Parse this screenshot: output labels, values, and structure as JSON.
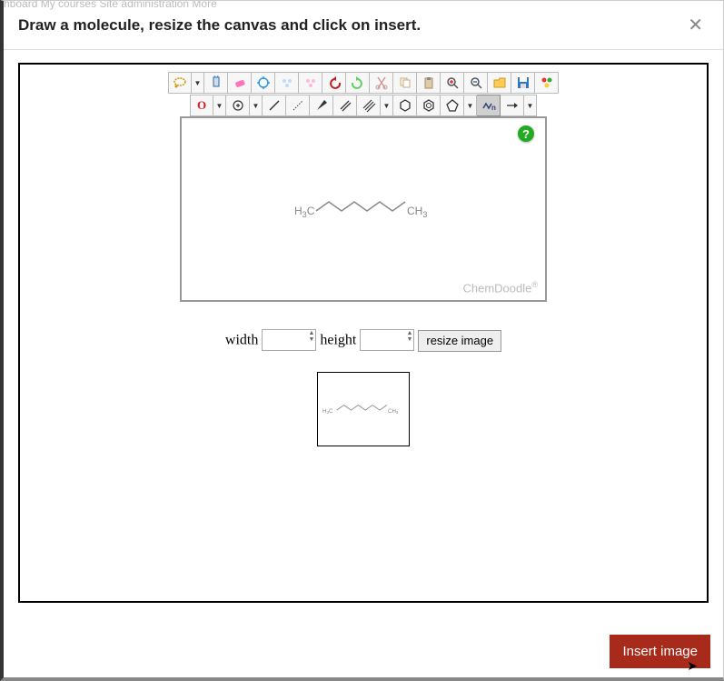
{
  "nav_hint": "hboard   My courses   Site administration   More",
  "header": {
    "title": "Draw a molecule, resize the canvas and click on insert."
  },
  "toolbar1": {
    "lasso": "lasso-icon",
    "clear": "clear-icon",
    "erase": "erase-icon",
    "center": "center-icon",
    "clean": "clean-icon",
    "clean2": "clean2-icon",
    "undo": "undo-icon",
    "redo": "redo-icon",
    "cut": "cut-icon",
    "copy": "copy-icon",
    "paste": "paste-icon",
    "zoom_in": "zoom-in-icon",
    "zoom_out": "zoom-out-icon",
    "open": "open-icon",
    "save": "save-icon",
    "template": "template-icon"
  },
  "toolbar2": {
    "element": "O",
    "charge": "charge-icon",
    "single": "single-bond-icon",
    "recessed": "recessed-bond-icon",
    "wedge": "wedge-bond-icon",
    "double": "double-bond-icon",
    "triple": "triple-bond-icon",
    "hex": "hexagon-icon",
    "benzene": "benzene-icon",
    "pent": "pentagon-icon",
    "chain": "chain-icon",
    "chain_label": "n",
    "arrow": "arrow-icon"
  },
  "canvas": {
    "help": "?",
    "watermark": "ChemDoodle",
    "reg": "®",
    "left_label": "H",
    "left_label_sub": "3",
    "left_label_c": "C",
    "right_label": "CH",
    "right_label_sub": "3"
  },
  "resize": {
    "width_label": "width",
    "height_label": "height",
    "width_value": "",
    "height_value": "",
    "button": "resize image"
  },
  "footer": {
    "insert": "Insert image"
  }
}
